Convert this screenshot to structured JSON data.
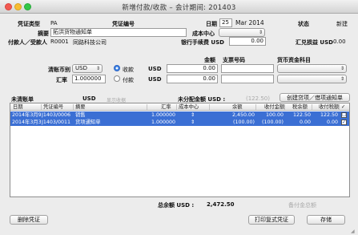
{
  "window": {
    "title": "新增付款/收款 – 会计期间: 201403"
  },
  "header": {
    "voucher_type_label": "凭证类型",
    "voucher_type_value": "PA",
    "voucher_no_label": "凭证编号",
    "date_label": "日期",
    "date_day": "25",
    "date_month_year": "Mar 2014",
    "status_label": "状态",
    "status_value": "新建",
    "summary_label": "摘要",
    "summary_value": "拓洪货物通知单",
    "cost_center_label": "成本中心",
    "payer_label": "付款人／受款人",
    "payer_code": "R0001",
    "payer_name": "同路科技公司",
    "bank_fee_label": "银行手续费 USD",
    "bank_fee_value": "0.00",
    "exchange_diff_label": "汇兑损益 USD",
    "exchange_diff_value": "0.00"
  },
  "clearing": {
    "currency_label": "清账币别",
    "currency_value": "USD",
    "rate_label": "汇率",
    "rate_value": "1.000000",
    "receive_label": "收款",
    "pay_label": "付款",
    "amount_header": "金额",
    "cheque_header": "支票号码",
    "fund_account_header": "货币资金科目",
    "row1_currency": "USD",
    "row1_amount": "0.00",
    "row2_currency": "USD",
    "row2_amount": "0.00"
  },
  "list_section": {
    "title": "未清账单",
    "currency": "USD",
    "show_receipts_label": "显示收据",
    "unallocated_label": "未分配金额 USD :",
    "unallocated_value": "(122.50)",
    "create_button": "创建贷项／借项通知单"
  },
  "table": {
    "columns": [
      "日期",
      "凭证编号",
      "摘要",
      "汇率",
      "成本中心",
      "余额",
      "收付金额",
      "税余额",
      "收付税额",
      "✓"
    ],
    "rows": [
      {
        "date": "2014年3月9日",
        "doc": "J1403/0006",
        "desc": "销售",
        "rate": "1.000000",
        "balance": "2,450.00",
        "payment": "100.00",
        "tax_balance": "122.50",
        "tax_payment": "122.50",
        "checked": "☐"
      },
      {
        "date": "2014年3月30日",
        "doc": "J1403/0011",
        "desc": "货项通知单",
        "rate": "1.000000",
        "balance": "(100.00)",
        "payment": "(100.00)",
        "tax_balance": "0.00",
        "tax_payment": "0.00",
        "checked": "✓"
      }
    ]
  },
  "footer": {
    "total_label": "总余额 USD :",
    "total_value": "2,472.50",
    "allocated_label": "备付金总额",
    "delete_button": "删除凭证",
    "print_button": "打印复式凭证",
    "save_button": "存储"
  }
}
